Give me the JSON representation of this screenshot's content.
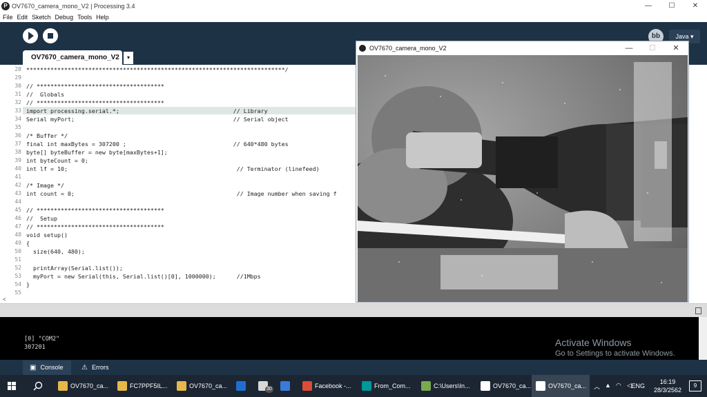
{
  "window": {
    "title": "OV7670_camera_mono_V2 | Processing 3.4",
    "controls": [
      "—",
      "☐",
      "✕"
    ]
  },
  "menu": {
    "items": [
      "File",
      "Edit",
      "Sketch",
      "Debug",
      "Tools",
      "Help"
    ]
  },
  "toolbar": {
    "mode_label": "Java ▾",
    "debug_icon": "bb"
  },
  "editor": {
    "active_tab": "OV7670_camera_mono_V2",
    "tab_menu": "▾",
    "highlighted_line": 33,
    "lines": [
      {
        "no": "28",
        "text": "***************************************************************************/"
      },
      {
        "no": "29",
        "text": ""
      },
      {
        "no": "30",
        "text": "// *************************************"
      },
      {
        "no": "31",
        "text": "//  Globals"
      },
      {
        "no": "32",
        "text": "// *************************************"
      },
      {
        "no": "33",
        "text": "import processing.serial.*;                                 // Library"
      },
      {
        "no": "34",
        "text": "Serial myPort;                                              // Serial object"
      },
      {
        "no": "35",
        "text": ""
      },
      {
        "no": "36",
        "text": "/* Buffer */"
      },
      {
        "no": "37",
        "text": "final int maxBytes = 307200 ;                               // 640*480 bytes"
      },
      {
        "no": "38",
        "text": "byte[] byteBuffer = new byte[maxBytes+1];"
      },
      {
        "no": "39",
        "text": "int byteCount = 0;"
      },
      {
        "no": "40",
        "text": "int lf = 10;                                                 // Terminator (linefeed)"
      },
      {
        "no": "41",
        "text": ""
      },
      {
        "no": "42",
        "text": "/* Image */"
      },
      {
        "no": "43",
        "text": "int count = 0;                                               // Image number when saving f"
      },
      {
        "no": "44",
        "text": ""
      },
      {
        "no": "45",
        "text": "// *************************************"
      },
      {
        "no": "46",
        "text": "//  Setup"
      },
      {
        "no": "47",
        "text": "// *************************************"
      },
      {
        "no": "48",
        "text": "void setup()"
      },
      {
        "no": "49",
        "text": "{"
      },
      {
        "no": "50",
        "text": "  size(640, 480);"
      },
      {
        "no": "51",
        "text": ""
      },
      {
        "no": "52",
        "text": "  printArray(Serial.list());"
      },
      {
        "no": "53",
        "text": "  myPort = new Serial(this, Serial.list()[0], 1000000);      //1Mbps"
      },
      {
        "no": "54",
        "text": "}"
      },
      {
        "no": "55",
        "text": ""
      }
    ],
    "scroll_left": "<"
  },
  "console": {
    "lines": [
      "[0] \"COM2\"",
      "307201"
    ],
    "tab_console": "Console",
    "tab_errors": "Errors",
    "watermark_title": "Activate Windows",
    "watermark_sub": "Go to Settings to activate Windows."
  },
  "sketch_window": {
    "title": "OV7670_camera_mono_V2",
    "controls": [
      "—",
      "☐",
      "✕"
    ]
  },
  "taskbar": {
    "items": [
      {
        "label": "OV7670_ca...",
        "color": "#e6b84a"
      },
      {
        "label": "FC7PPF5IL...",
        "color": "#e6b84a"
      },
      {
        "label": "OV7670_ca...",
        "color": "#e6b84a"
      },
      {
        "label": "",
        "color": "#1f6fd1"
      },
      {
        "label": "",
        "color": "#d8d8d8"
      },
      {
        "label": "",
        "color": "#3b7bd8"
      },
      {
        "label": "Facebook -...",
        "color": "#dd4b39"
      },
      {
        "label": "From_Com...",
        "color": "#00979d"
      },
      {
        "label": "C:\\Users\\In...",
        "color": "#7aa94f"
      },
      {
        "label": "OV7670_ca...",
        "color": "#ffffff"
      },
      {
        "label": "OV7670_ca...",
        "color": "#ffffff"
      }
    ],
    "badge": "30",
    "lang": "ENG",
    "time": "16:19",
    "date": "28/3/2562",
    "notif": "9"
  }
}
